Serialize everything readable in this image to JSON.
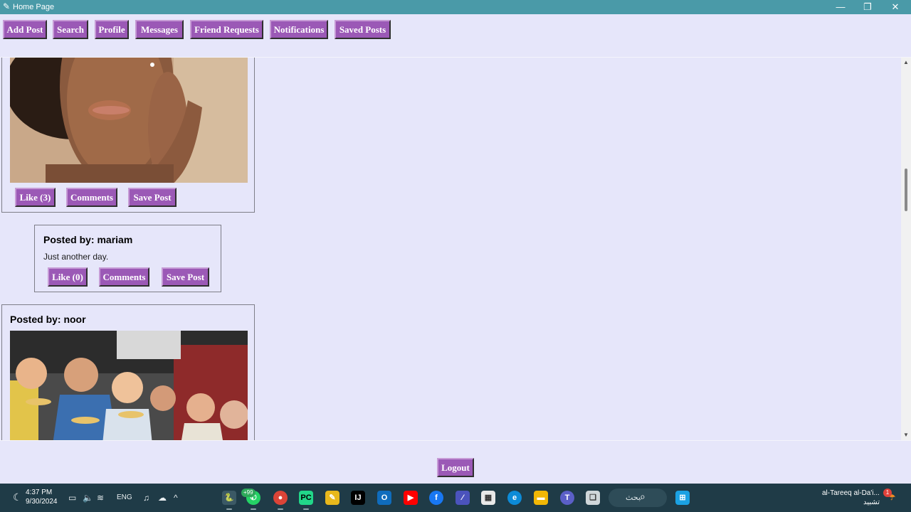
{
  "window": {
    "title": "Home Page",
    "minimize": "—",
    "maximize": "❐",
    "close": "✕"
  },
  "toolbar": {
    "add_post": "Add Post",
    "search": "Search",
    "profile": "Profile",
    "messages": "Messages",
    "friend_requests": "Friend Requests",
    "notifications": "Notifications",
    "saved_posts": "Saved Posts"
  },
  "posts": [
    {
      "like": "Like (3)",
      "comments": "Comments",
      "save": "Save Post",
      "image_icon": "woman-face-photo"
    },
    {
      "author": "Posted by: mariam",
      "content": "Just another day.",
      "like": "Like (0)",
      "comments": "Comments",
      "save": "Save Post"
    },
    {
      "author": "Posted by: noor",
      "image_icon": "family-eating-pizza-photo"
    }
  ],
  "logout": "Logout",
  "taskbar": {
    "time": "4:37 PM",
    "date": "9/30/2024",
    "lang": "ENG",
    "search_text": "بحث",
    "whatsapp_badge": "+99",
    "weather_line1": "al-Tareeq al-Da'i...",
    "weather_line2": "تشبيد",
    "notification_count": "1"
  },
  "colors": {
    "background": "#E6E6FA",
    "button": "#9B59B6",
    "titlebar": "#4A9AA8",
    "taskbar": "#1F3B47"
  }
}
